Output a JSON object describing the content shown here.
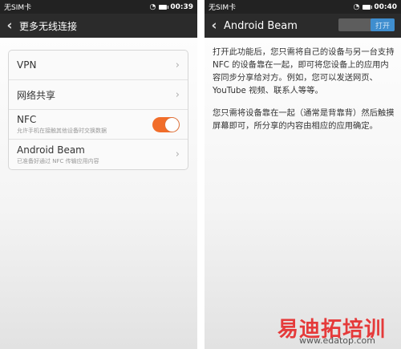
{
  "left": {
    "status": {
      "carrier": "无SIM卡",
      "time": "00:39"
    },
    "title": "更多无线连接",
    "rows": [
      {
        "label": "VPN",
        "sub": ""
      },
      {
        "label": "网络共享",
        "sub": ""
      },
      {
        "label": "NFC",
        "sub": "允许手机在接触其他设备时交换数据",
        "toggle_on": true
      },
      {
        "label": "Android Beam",
        "sub": "已准备好通过 NFC 传输应用内容"
      }
    ]
  },
  "right": {
    "status": {
      "carrier": "无SIM卡",
      "time": "00:40"
    },
    "title": "Android Beam",
    "toggle_label": "打开",
    "paragraphs": [
      "打开此功能后，您只需将自己的设备与另一台支持 NFC 的设备靠在一起，即可将您设备上的应用内容同步分享给对方。例如，您可以发送网页、YouTube 视频、联系人等等。",
      "您只需将设备靠在一起（通常是背靠背）然后触摸屏幕即可，所分享的内容由相应的应用确定。"
    ]
  },
  "watermark": {
    "cn": "易迪拓培训",
    "url": "www.edatop.com"
  },
  "colors": {
    "accent": "#f16d2a",
    "toggle_blue": "#3f8ecf",
    "watermark": "#e53a3a"
  }
}
